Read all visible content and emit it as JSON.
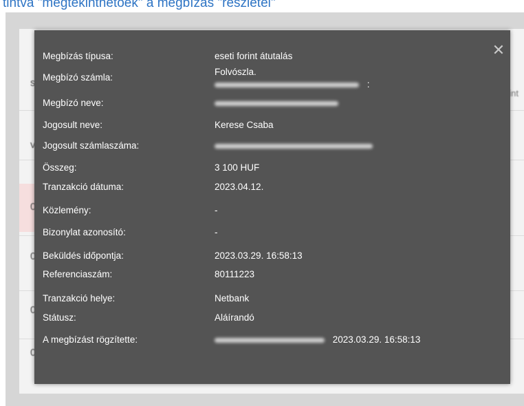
{
  "header": {
    "caption": "tintva \"megtekinthetőek\" a megbízás \"részletei\""
  },
  "dialog": {
    "close_symbol": "✕",
    "rows": [
      {
        "label": "Megbízás típusa:",
        "value": "eseti forint átutalás"
      },
      {
        "label": "Megbízó számla:",
        "value": "Folvószla."
      },
      {
        "label": "Megbízó neve:",
        "value": ""
      },
      {
        "label": "Jogosult neve:",
        "value": "Kerese Csaba"
      },
      {
        "label": "Jogosult számlaszáma:",
        "value": ""
      },
      {
        "label": "Összeg:",
        "value": "3 100 HUF"
      },
      {
        "label": "Tranzakció dátuma:",
        "value": "2023.04.12."
      },
      {
        "label": "Közlemény:",
        "value": "-"
      },
      {
        "label": "Bizonylat azonosító:",
        "value": "-"
      },
      {
        "label": "Beküldés időpontja:",
        "value": "2023.03.29. 16:58:13"
      },
      {
        "label": "Referenciaszám:",
        "value": "80111223"
      },
      {
        "label": "Tranzakció helye:",
        "value": "Netbank"
      },
      {
        "label": "Státusz:",
        "value": "Aláírandó"
      },
      {
        "label": "A megbízást rögzítette:",
        "value": "2023.03.29. 16:58:13"
      }
    ],
    "account_suffix": ":"
  },
  "colors": {
    "modal_bg": "#545454",
    "backdrop": "#d6d6d6",
    "caption": "#2e74c4",
    "text": "#ffffff"
  }
}
